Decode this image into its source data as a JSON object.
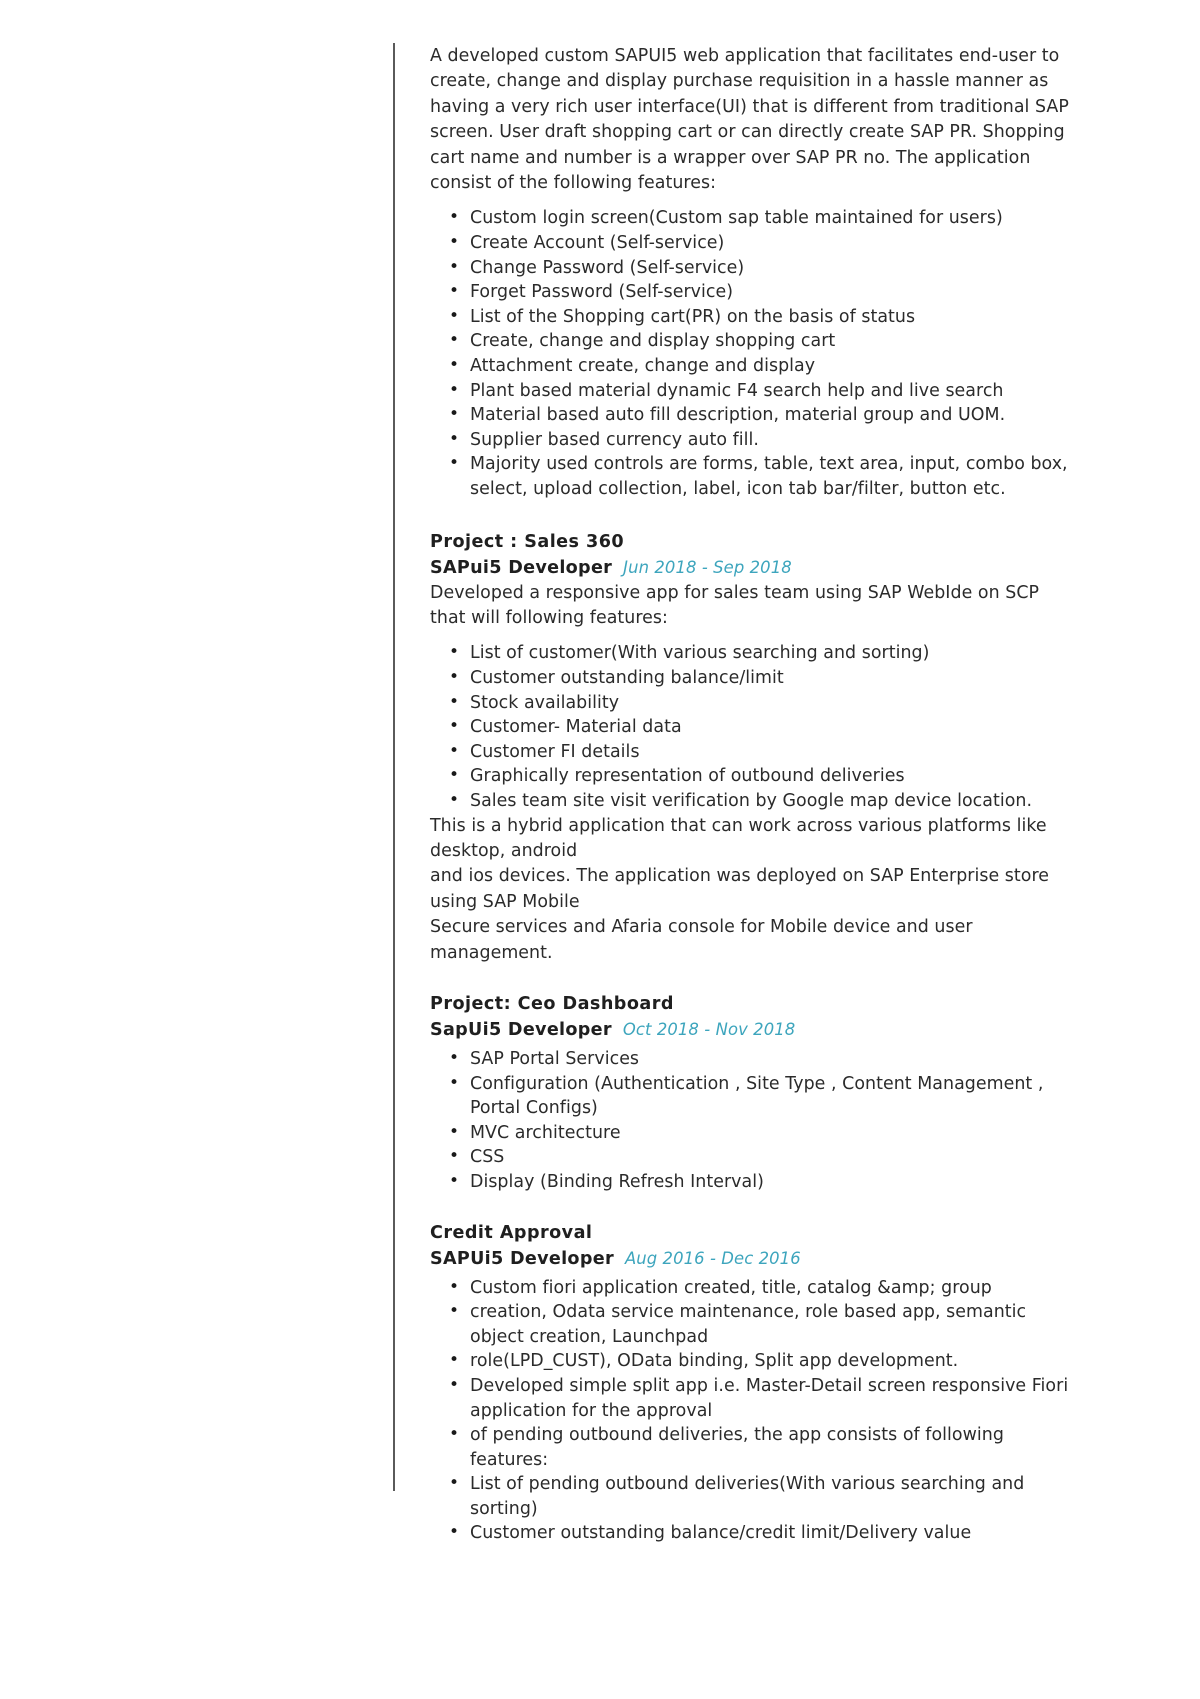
{
  "document": {
    "type": "resume-experience-section",
    "accent_color": "#3da5bd",
    "text_color": "#2b2b2b",
    "rule_color": "#5a5a5a"
  },
  "intro": {
    "paragraph": "A developed custom SAPUI5 web application that facilitates end-user to create, change and display purchase requisition in a hassle manner as having a very rich user interface(UI) that is different from traditional SAP screen. User draft shopping cart or can directly create SAP PR. Shopping cart name and number is a wrapper over SAP PR no. The application consist of the following features:",
    "features": [
      "Custom login screen(Custom sap table maintained for users)",
      "Create Account (Self-service)",
      "Change Password (Self-service)",
      "Forget Password (Self-service)",
      "List of the Shopping cart(PR) on the basis of status",
      "Create, change and display shopping cart",
      "Attachment create, change and display",
      "Plant based material dynamic F4 search help and live search",
      "Material based auto fill description, material group and UOM.",
      "Supplier based currency auto fill.",
      "Majority used controls are forms, table, text area, input, combo box, select, upload collection, label, icon tab bar/filter, button etc."
    ]
  },
  "projects": [
    {
      "title": "Project : Sales 360",
      "role": "SAPui5 Developer",
      "dates": "Jun 2018 - Sep 2018",
      "description": "Developed a responsive app for sales team using SAP WebIde on SCP that will following features:",
      "bullets": [
        "List of customer(With various searching and sorting)",
        "Customer outstanding balance/limit",
        "Stock availability",
        "Customer- Material data",
        "Customer FI details",
        "Graphically representation of outbound deliveries",
        "Sales team site visit verification by Google map device location."
      ],
      "closing_paragraphs": [
        "This is a hybrid application that can work across various platforms like desktop, android",
        "and ios devices. The application was deployed on SAP Enterprise store using SAP Mobile",
        "Secure services and Afaria console for Mobile device and user management."
      ]
    },
    {
      "title": "Project: Ceo Dashboard",
      "role": "SapUi5 Developer",
      "dates": "Oct 2018 - Nov 2018",
      "description": "",
      "bullets": [
        "SAP Portal Services",
        "Configuration (Authentication , Site Type , Content Management , Portal Configs)",
        "MVC architecture",
        "CSS",
        "Display (Binding Refresh Interval)"
      ],
      "closing_paragraphs": []
    },
    {
      "title": "Credit Approval",
      "role": "SAPUi5 Developer",
      "dates": "Aug 2016 - Dec 2016",
      "description": "",
      "bullets": [
        "Custom fiori application created, title, catalog &amp; group",
        "creation, Odata service maintenance, role based app, semantic object creation, Launchpad",
        "role(LPD_CUST), OData binding, Split app development.",
        "Developed simple split app i.e. Master-Detail screen responsive Fiori application for the approval",
        "of pending outbound deliveries, the app consists of following features:",
        "List of pending outbound deliveries(With various searching and sorting)",
        "Customer outstanding balance/credit limit/Delivery value"
      ],
      "closing_paragraphs": []
    }
  ]
}
